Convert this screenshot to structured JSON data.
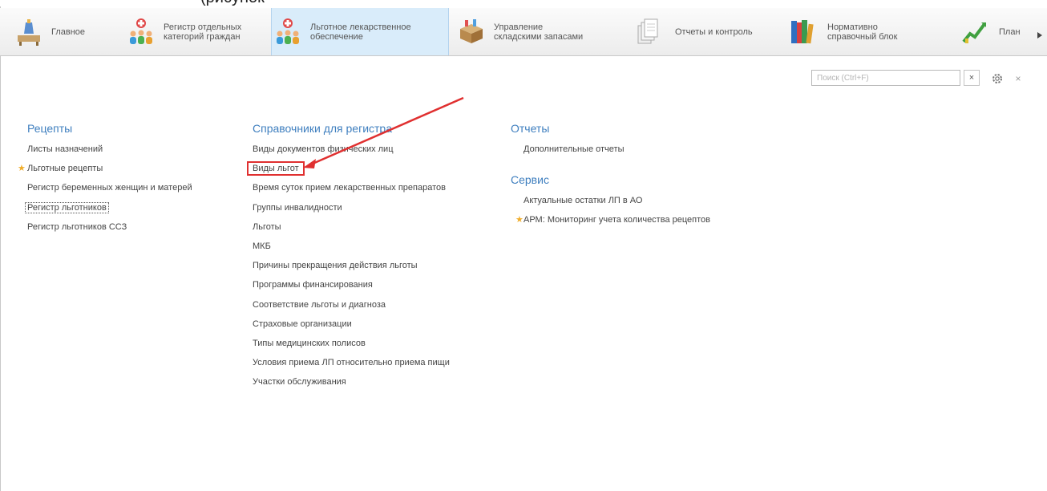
{
  "caption": "(рисунок",
  "sections": [
    {
      "label": "Главное",
      "icon": "desk-icon",
      "active": false
    },
    {
      "label": "Регистр отдельных категорий граждан",
      "icon": "people-cross-icon",
      "active": false
    },
    {
      "label": "Льготное лекарственное обеспечение",
      "icon": "people-cross-icon",
      "active": true
    },
    {
      "label": "Управление складскими запасами",
      "icon": "boxes-icon",
      "active": false
    },
    {
      "label": "Отчеты и контроль",
      "icon": "documents-icon",
      "active": false
    },
    {
      "label": "Нормативно справочный блок",
      "icon": "books-icon",
      "active": false
    },
    {
      "label": "План",
      "icon": "chart-icon",
      "active": false
    }
  ],
  "search": {
    "placeholder": "Поиск (Ctrl+F)",
    "value": ""
  },
  "toolbar": {
    "clear": "×",
    "close": "×"
  },
  "columns": {
    "recipes": {
      "title": "Рецепты",
      "items": [
        "Листы назначений",
        "Льготные рецепты",
        "Регистр беременных женщин и матерей",
        "Регистр льготников",
        "Регистр льготников ССЗ"
      ]
    },
    "references": {
      "title": "Справочники для регистра",
      "items": [
        "Виды документов физических лиц",
        "Виды льгот",
        "Время суток прием лекарственных препаратов",
        "Группы инвалидности",
        "Льготы",
        "МКБ",
        "Причины прекращения действия льготы",
        "Программы финансирования",
        "Соответствие льготы и диагноза",
        "Страховые организации",
        "Типы медицинских полисов",
        "Условия приема ЛП относительно приема пищи",
        "Участки обслуживания"
      ]
    },
    "reports": {
      "title": "Отчеты",
      "items": [
        "Дополнительные отчеты"
      ]
    },
    "service": {
      "title": "Сервис",
      "items": [
        "Актуальные остатки ЛП в АО",
        "АРМ: Мониторинг учета количества рецептов"
      ]
    }
  },
  "colors": {
    "accent": "#3f7fbf",
    "active_section": "#d9ecfa",
    "highlight": "#e03030",
    "star": "#f0ad2b"
  }
}
